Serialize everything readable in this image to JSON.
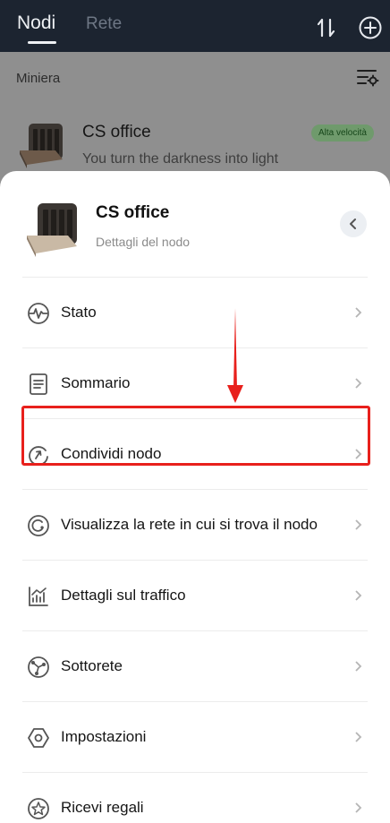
{
  "header": {
    "tabs": [
      {
        "label": "Nodi",
        "active": true
      },
      {
        "label": "Rete",
        "active": false
      }
    ],
    "icons": [
      "sort-icon",
      "add-icon"
    ]
  },
  "background": {
    "section_title": "Miniera",
    "node": {
      "name": "CS office",
      "subtitle": "You turn the darkness into light",
      "badge": "Alta velocità"
    }
  },
  "sheet": {
    "title": "CS office",
    "subtitle": "Dettagli del nodo",
    "menu": [
      {
        "label": "Stato",
        "icon": "pulse-icon"
      },
      {
        "label": "Sommario",
        "icon": "document-icon"
      },
      {
        "label": "Condividi nodo",
        "icon": "share-icon",
        "highlighted": true
      },
      {
        "label": "Visualizza la rete in cui si trova il nodo",
        "icon": "network-view-icon"
      },
      {
        "label": "Dettagli sul traffico",
        "icon": "traffic-chart-icon"
      },
      {
        "label": "Sottorete",
        "icon": "subnet-icon"
      },
      {
        "label": "Impostazioni",
        "icon": "settings-icon"
      },
      {
        "label": "Ricevi regali",
        "icon": "gift-star-icon"
      }
    ]
  },
  "colors": {
    "topbar": "#1c2430",
    "highlight": "#e8201c",
    "badge_bg": "#6f9a6c"
  }
}
